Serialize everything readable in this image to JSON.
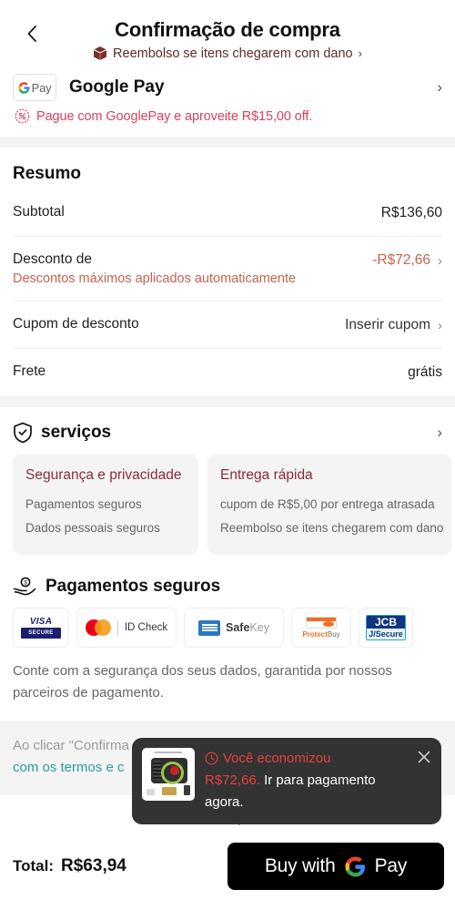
{
  "header": {
    "back_icon": "chevron-left-icon",
    "title": "Confirmação de compra",
    "refund_icon": "package-icon",
    "refund_text": "Reembolso se itens chegarem com dano",
    "refund_chevron": "›"
  },
  "payment": {
    "badge_g": "G",
    "badge_pay": "Pay",
    "method_name": "Google Pay",
    "chevron": "›",
    "promo_icon": "percent-badge-icon",
    "promo_text": "Pague com GooglePay e aproveite R$15,00 off."
  },
  "summary": {
    "title": "Resumo",
    "rows": [
      {
        "label": "Subtotal",
        "sub": "",
        "value": "R$136,60",
        "chevron": "",
        "accent": false
      },
      {
        "label": "Desconto de",
        "sub": "Descontos máximos aplicados automaticamente",
        "value": "-R$72,66",
        "chevron": "›",
        "accent": true
      },
      {
        "label": "Cupom de desconto",
        "sub": "",
        "value": "Inserir cupom",
        "chevron": "›",
        "accent": false
      },
      {
        "label": "Frete",
        "sub": "",
        "value": "grátis",
        "chevron": "",
        "accent": false
      }
    ]
  },
  "services": {
    "icon": "shield-check-icon",
    "title": "serviços",
    "chevron": "›",
    "cards": [
      {
        "title": "Segurança e privacidade",
        "items": [
          "Pagamentos seguros",
          "Dados pessoais seguros"
        ]
      },
      {
        "title": "Entrega rápida",
        "items": [
          "cupom de R$5,00 por entrega atrasada",
          "Reembolso se itens chegarem com dano"
        ]
      }
    ]
  },
  "secure_payments": {
    "icon": "hand-coin-icon",
    "title": "Pagamentos seguros",
    "logos": [
      {
        "name": "visa-secure-logo",
        "word": "VISA",
        "tag": "SECURE"
      },
      {
        "name": "mastercard-id-check-logo",
        "text": "ID Check"
      },
      {
        "name": "amex-safekey-logo",
        "bold": "Safe",
        "light": "Key",
        "sup": "˙"
      },
      {
        "name": "discover-protectbuy-logo",
        "bold": "Protect",
        "light": "Buy"
      },
      {
        "name": "jcb-jsecure-logo",
        "top": "JCB",
        "bottom": "J/Secure"
      }
    ],
    "note": "Conte com a segurança dos seus dados, garantida por nossos parceiros de pagamento."
  },
  "terms": {
    "prefix": "Ao clicar \"Confirma",
    "line2_link": "com os termos e c",
    "line2_rest": ""
  },
  "toast": {
    "clock_icon": "clock-icon",
    "close_icon": "close-icon",
    "headline": "Você economizou",
    "amount": "R$72,66.",
    "cta": "Ir para pagamento agora.",
    "thumbnail_name": "product-thumbnail"
  },
  "footer": {
    "total_label": "Total:",
    "total_value": "R$63,94",
    "buy_prefix": "Buy with",
    "buy_pay": "Pay",
    "buy_icon": "google-g-icon"
  },
  "colors": {
    "accent_red": "#c4634f",
    "promo_pink": "#d9415f",
    "link_teal": "#2a9d9d",
    "toast_bg": "#333333",
    "toast_red": "#e8413c",
    "card_bg": "#f4f4f4"
  }
}
